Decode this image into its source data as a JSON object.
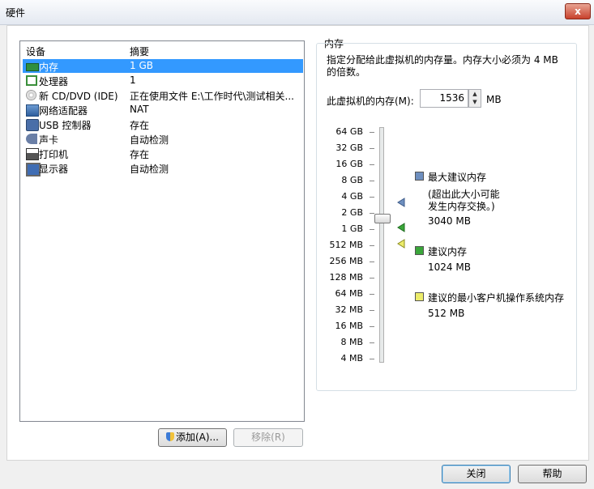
{
  "window": {
    "title": "硬件",
    "close_glyph": "x"
  },
  "device_list": {
    "headers": [
      "设备",
      "摘要"
    ],
    "rows": [
      {
        "name": "内存",
        "summary": "1 GB",
        "icon": "memory-icon",
        "selected": true
      },
      {
        "name": "处理器",
        "summary": "1",
        "icon": "processor-icon"
      },
      {
        "name": "新 CD/DVD (IDE)",
        "summary": "正在使用文件 E:\\工作时代\\测试相关...",
        "icon": "cd-dvd-icon"
      },
      {
        "name": "网络适配器",
        "summary": "NAT",
        "icon": "network-adapter-icon"
      },
      {
        "name": "USB 控制器",
        "summary": "存在",
        "icon": "usb-icon"
      },
      {
        "name": "声卡",
        "summary": "自动检测",
        "icon": "sound-card-icon"
      },
      {
        "name": "打印机",
        "summary": "存在",
        "icon": "printer-icon"
      },
      {
        "name": "显示器",
        "summary": "自动检测",
        "icon": "display-icon"
      }
    ]
  },
  "buttons": {
    "add": "添加(A)...",
    "remove": "移除(R)",
    "close": "关闭",
    "help": "帮助"
  },
  "memory": {
    "group_title": "内存",
    "description": "指定分配给此虚拟机的内存量。内存大小必须为 4 MB 的倍数。",
    "field_label": "此虚拟机的内存(M):",
    "value": "1536",
    "unit": "MB",
    "scale": [
      "64 GB",
      "32 GB",
      "16 GB",
      "8 GB",
      "4 GB",
      "2 GB",
      "1 GB",
      "512 MB",
      "256 MB",
      "128 MB",
      "64 MB",
      "32 MB",
      "16 MB",
      "8 MB",
      "4 MB"
    ],
    "legend": {
      "max": {
        "label": "最大建议内存",
        "note": "(超出此大小可能\n发生内存交换。)",
        "value": "3040 MB",
        "color": "#6e8fbf"
      },
      "recommended": {
        "label": "建议内存",
        "value": "1024 MB",
        "color": "#3aa63a"
      },
      "min": {
        "label": "建议的最小客户机操作系统内存",
        "value": "512 MB",
        "color": "#ecec6a"
      }
    }
  }
}
